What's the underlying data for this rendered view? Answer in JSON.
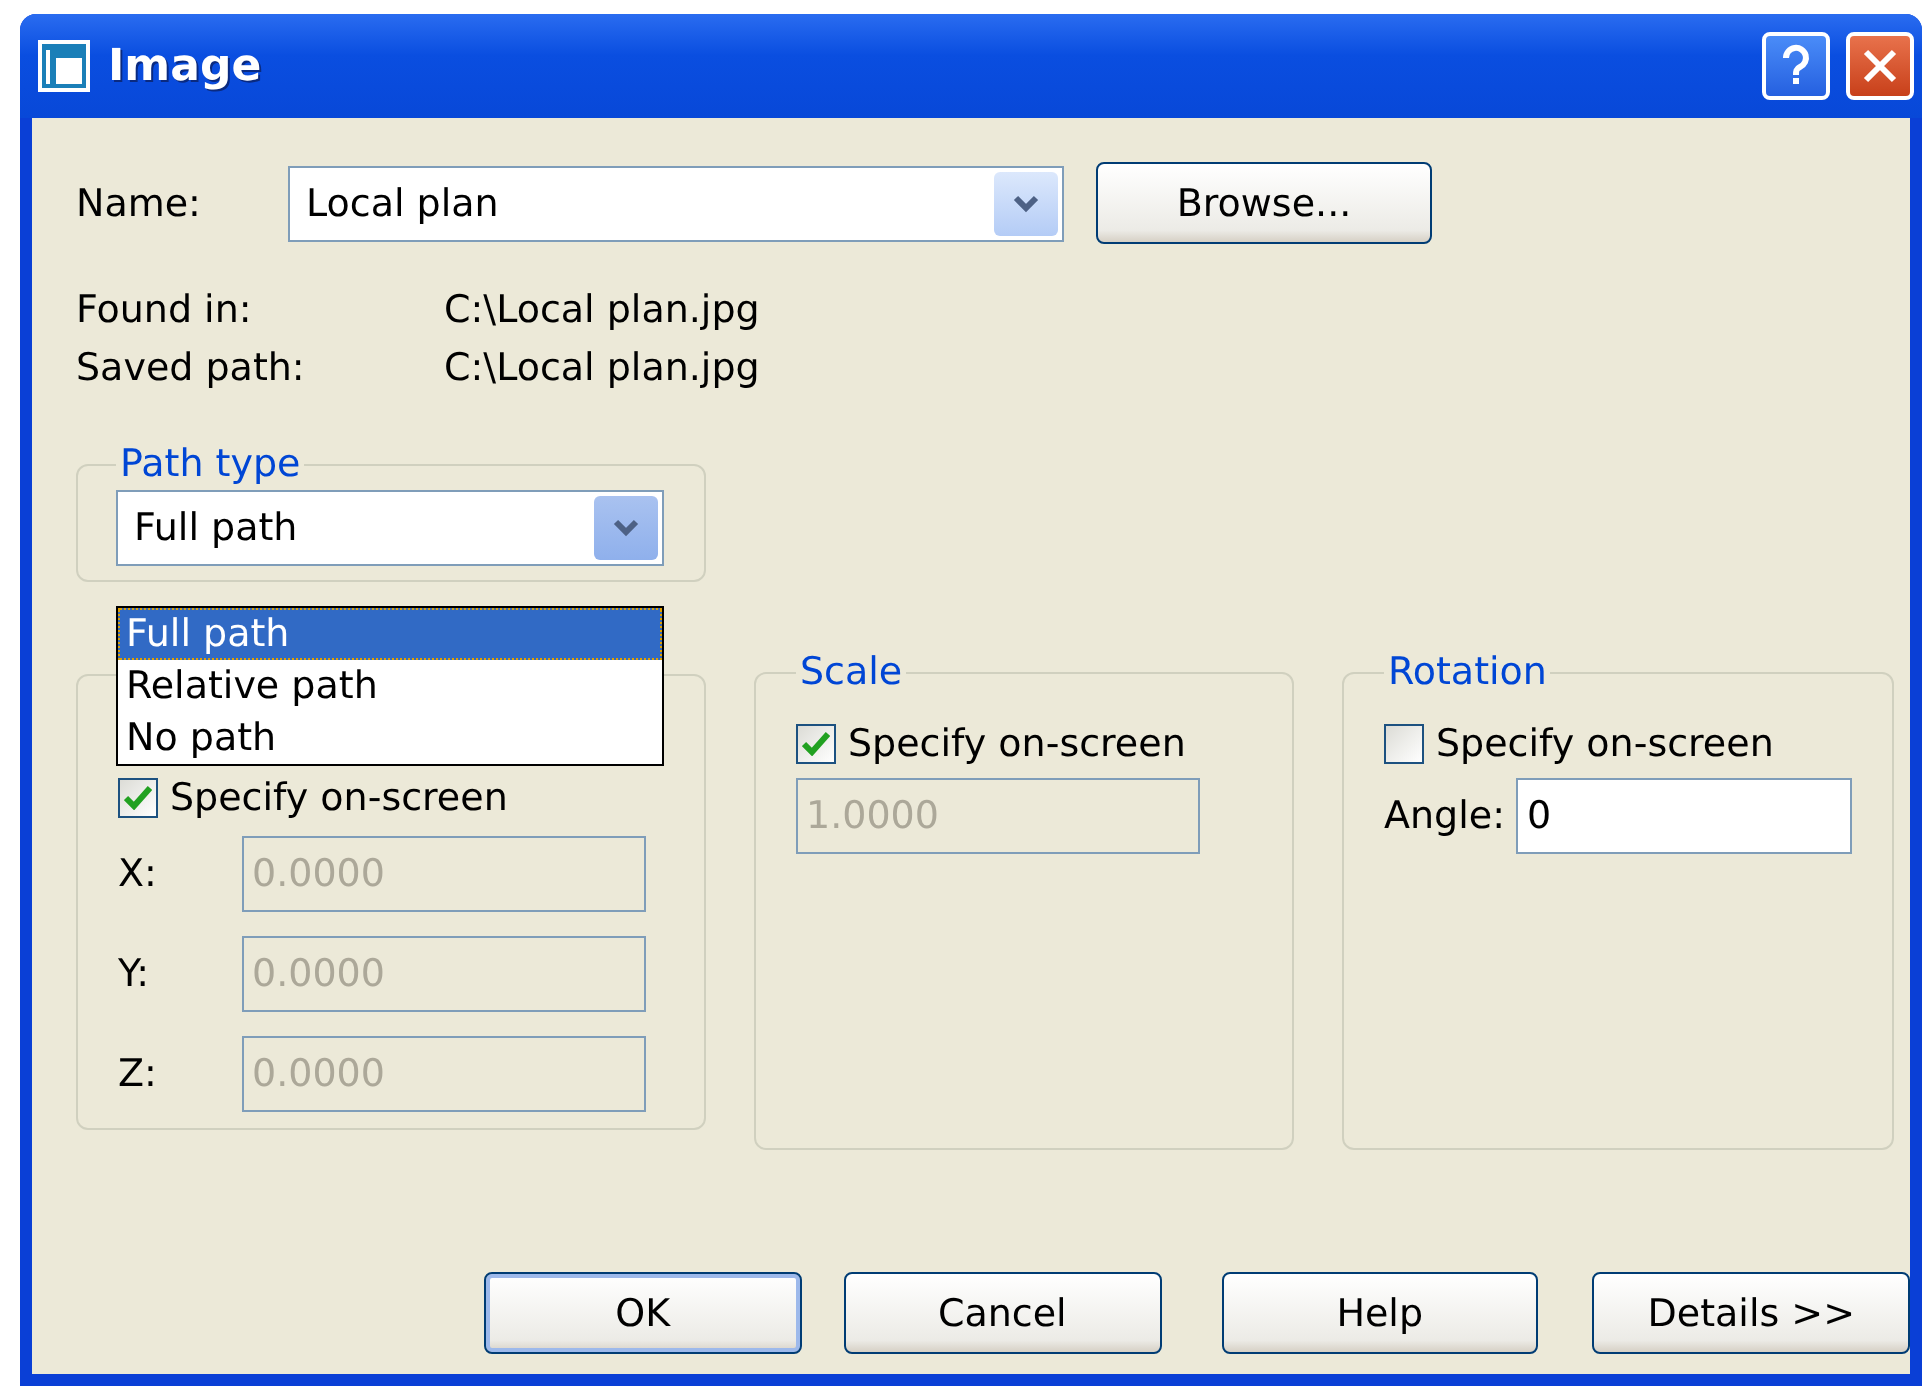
{
  "window": {
    "title": "Image"
  },
  "name_field": {
    "label": "Name:",
    "value": "Local plan"
  },
  "browse_button": {
    "label": "Browse..."
  },
  "info": [
    {
      "label": "Found in:",
      "value": "C:\\Local plan.jpg"
    },
    {
      "label": "Saved path:",
      "value": "C:\\Local plan.jpg"
    }
  ],
  "path_type": {
    "title": "Path type",
    "value": "Full path",
    "expanded": true,
    "options": [
      {
        "label": "Full path",
        "selected": true
      },
      {
        "label": "Relative path",
        "selected": false
      },
      {
        "label": "No path",
        "selected": false
      }
    ]
  },
  "insertion": {
    "specify": {
      "label": "Specify on-screen",
      "checked": true
    },
    "fields": [
      {
        "label": "X:",
        "value": "0.0000",
        "disabled": true
      },
      {
        "label": "Y:",
        "value": "0.0000",
        "disabled": true
      },
      {
        "label": "Z:",
        "value": "0.0000",
        "disabled": true
      }
    ]
  },
  "scale": {
    "title": "Scale",
    "specify": {
      "label": "Specify on-screen",
      "checked": true
    },
    "value": "1.0000",
    "disabled": true
  },
  "rotation": {
    "title": "Rotation",
    "specify": {
      "label": "Specify on-screen",
      "checked": false
    },
    "angle": {
      "label": "Angle:",
      "value": "0",
      "disabled": false
    }
  },
  "buttons": [
    {
      "label": "OK",
      "default": true
    },
    {
      "label": "Cancel",
      "default": false
    },
    {
      "label": "Help",
      "default": false
    },
    {
      "label": "Details >>",
      "default": false
    }
  ]
}
